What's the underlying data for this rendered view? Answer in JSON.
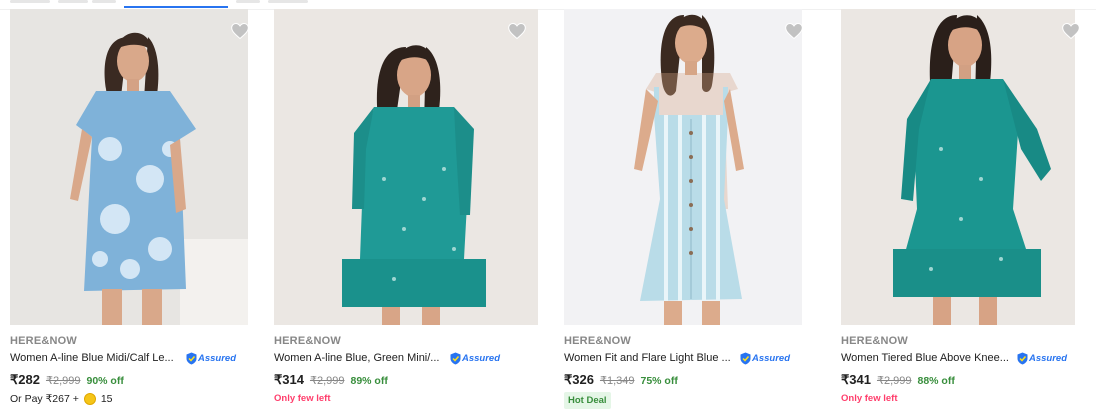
{
  "products": [
    {
      "brand": "HERE&NOW",
      "title": "Women A-line Blue Midi/Calf Le...",
      "assured": "Assured",
      "price": "₹282",
      "mrp": "₹2,999",
      "discount": "90% off",
      "extra_type": "orpay",
      "orpay_text": "Or Pay ₹267 +",
      "orpay_coins": "15",
      "image_bg": "#e7e5e2",
      "dress_color": "#7fb2d9"
    },
    {
      "brand": "HERE&NOW",
      "title": "Women A-line Blue, Green Mini/...",
      "assured": "Assured",
      "price": "₹314",
      "mrp": "₹2,999",
      "discount": "89% off",
      "extra_type": "fewleft",
      "extra_text": "Only few left",
      "image_bg": "#ebe7e3",
      "dress_color": "#1f9a96"
    },
    {
      "brand": "HERE&NOW",
      "title": "Women Fit and Flare Light Blue ...",
      "assured": "Assured",
      "price": "₹326",
      "mrp": "₹1,349",
      "discount": "75% off",
      "extra_type": "hotdeal",
      "extra_text": "Hot Deal",
      "image_bg": "#f2f2f4",
      "dress_color": "#b9dce8"
    },
    {
      "brand": "HERE&NOW",
      "title": "Women Tiered Blue Above Knee...",
      "assured": "Assured",
      "price": "₹341",
      "mrp": "₹2,999",
      "discount": "88% off",
      "extra_type": "fewleft",
      "extra_text": "Only few left",
      "image_bg": "#ebe7e3",
      "dress_color": "#1b9690"
    }
  ],
  "icons": {
    "wishlist": "heart-icon",
    "assured": "assured-shield-icon",
    "coin": "supercoin-icon"
  },
  "colors": {
    "price_green": "#388e3c",
    "few_left": "#ff3e6c",
    "assured_blue": "#2874f0",
    "heart_grey": "#c2c2c2"
  }
}
